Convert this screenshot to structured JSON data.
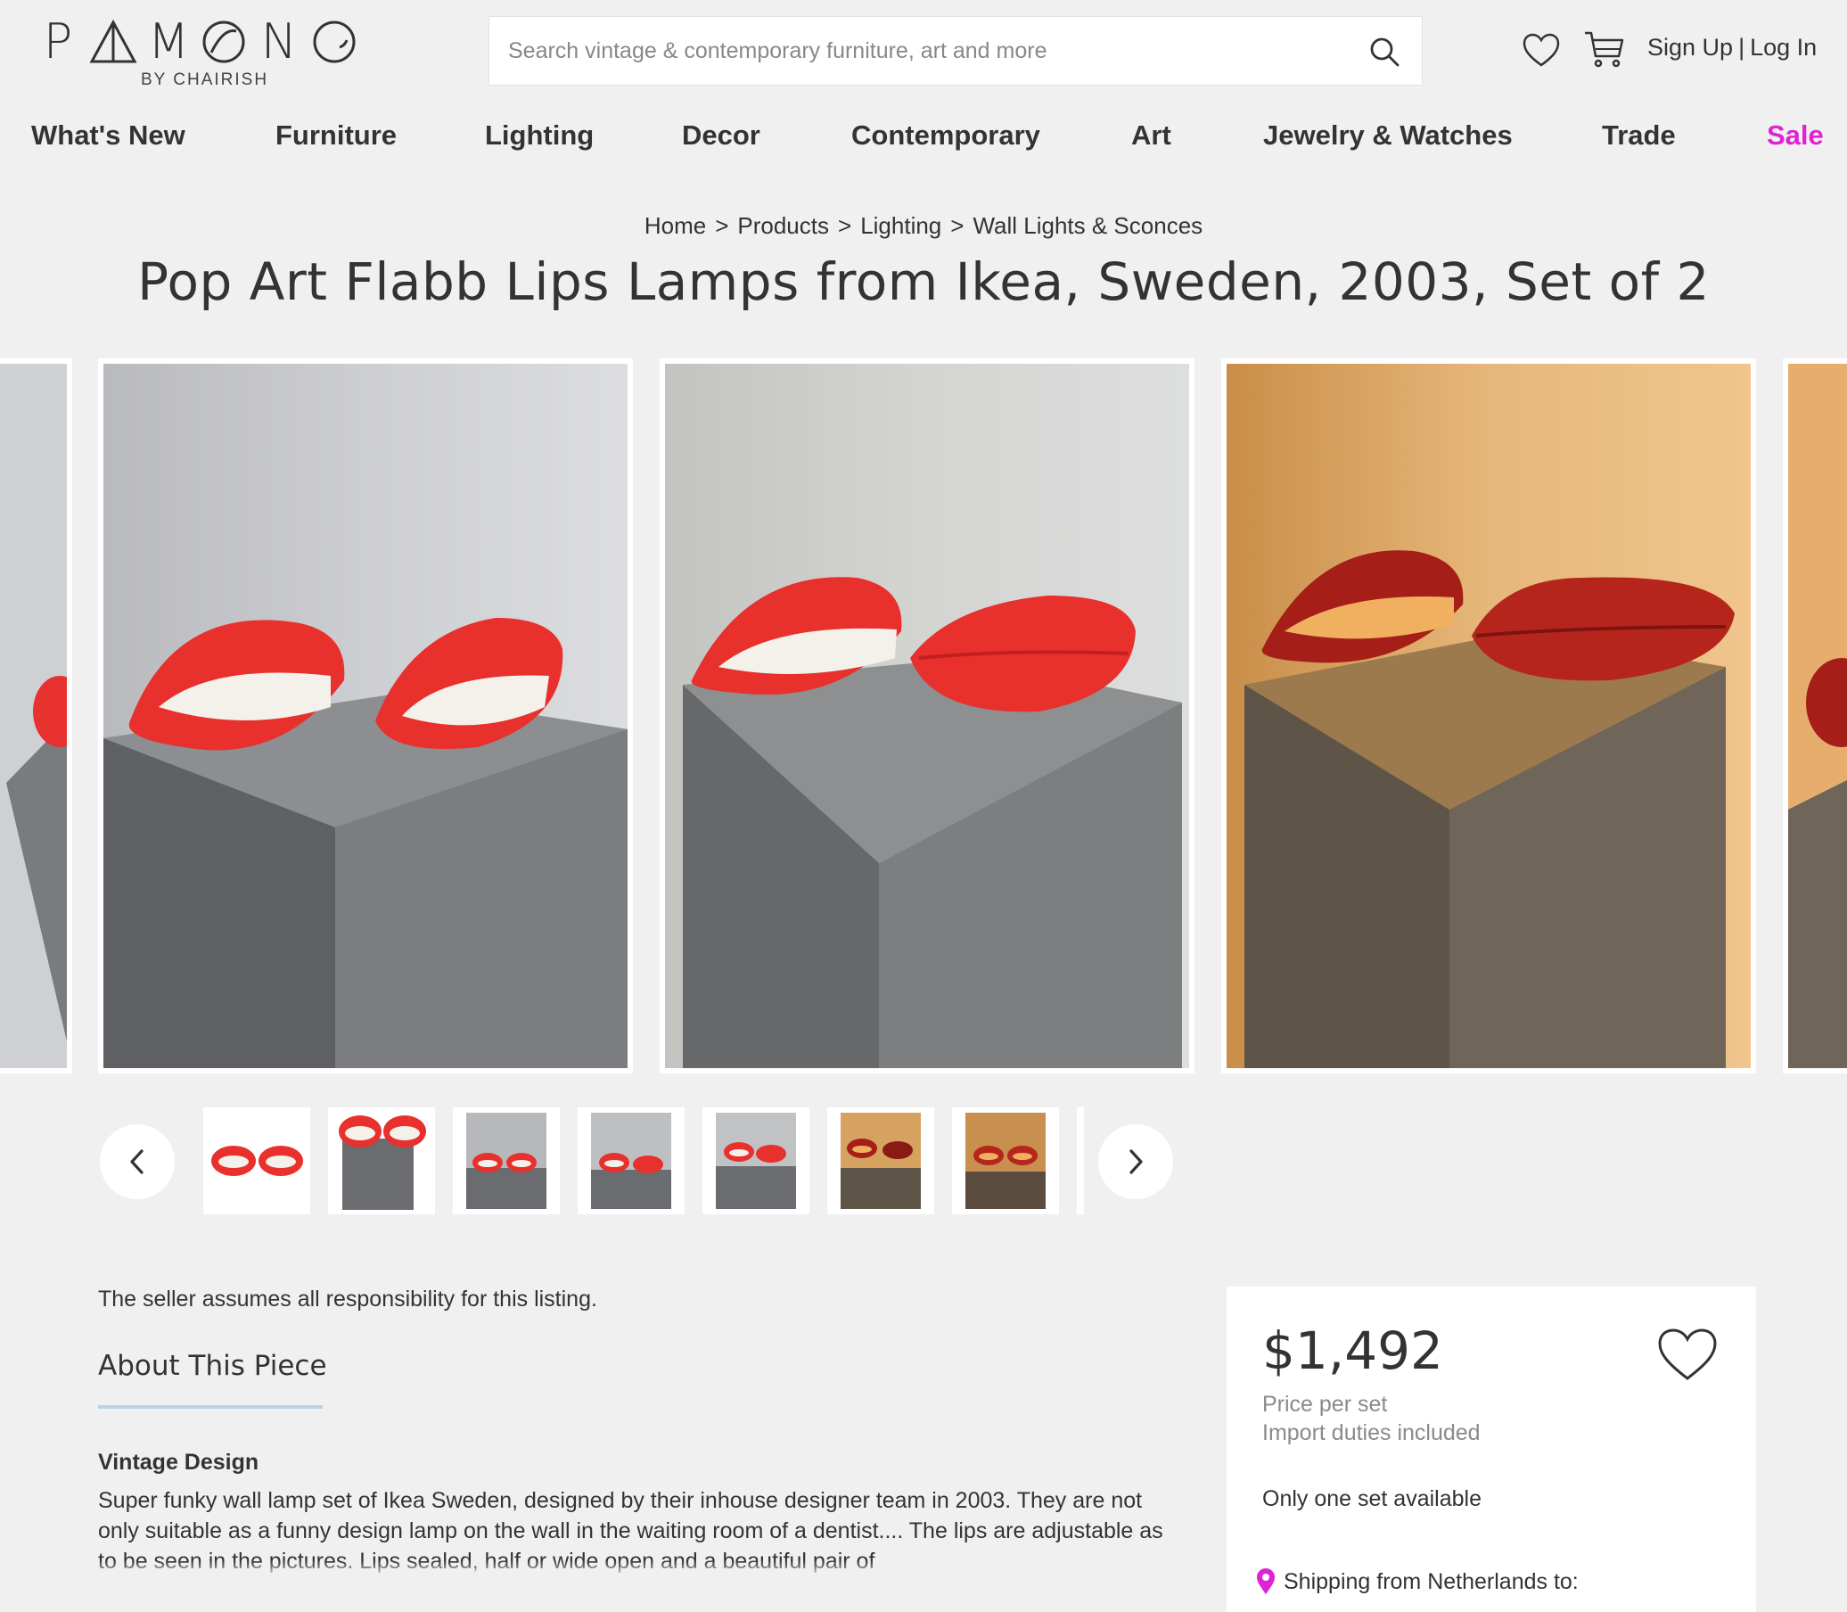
{
  "brand": {
    "name": "PAMONO",
    "letters": [
      "P",
      "A",
      "M",
      "O",
      "N",
      "O"
    ],
    "sub": "BY CHAIRISH"
  },
  "search": {
    "placeholder": "Search vintage & contemporary furniture, art and more",
    "icon": "search-icon"
  },
  "header": {
    "wishlist_icon": "heart-icon",
    "cart_icon": "cart-icon",
    "sign_up": "Sign Up",
    "separator": "|",
    "log_in": "Log In"
  },
  "nav": {
    "items": [
      {
        "label": "What's New"
      },
      {
        "label": "Furniture"
      },
      {
        "label": "Lighting"
      },
      {
        "label": "Decor"
      },
      {
        "label": "Contemporary"
      },
      {
        "label": "Art"
      },
      {
        "label": "Jewelry & Watches"
      },
      {
        "label": "Trade"
      },
      {
        "label": "Sale"
      }
    ],
    "sale_color": "#e021d6"
  },
  "breadcrumb": {
    "items": [
      "Home",
      "Products",
      "Lighting",
      "Wall Lights & Sconces"
    ],
    "separator": ">"
  },
  "product": {
    "title": "Pop Art Flabb Lips Lamps from Ikea, Sweden, 2003, Set of 2",
    "seller_note": "The seller assumes all responsibility for this listing.",
    "about_heading": "About This Piece",
    "section_heading": "Vintage Design",
    "description": "Super funky wall lamp set of Ikea Sweden, designed by their inhouse designer team in 2003. They are not only suitable as a funny design lamp on the wall in the waiting room of a dentist.... The lips are adjustable as to be seen in the pictures. Lips sealed, half or wide open and a beautiful pair of"
  },
  "gallery": {
    "images": [
      "lips-lamps-photo",
      "lips-lamps-photo",
      "lips-lamps-photo-lit"
    ],
    "prev_icon": "chevron-left-icon",
    "next_icon": "chevron-right-icon",
    "thumbnail_count": 7
  },
  "pricing": {
    "price": "$1,492",
    "per": "Price per set",
    "duties": "Import duties included",
    "availability": "Only one set available",
    "shipping": "Shipping from Netherlands to:",
    "shipping_icon": "location-pin-icon",
    "favorite_icon": "heart-icon"
  }
}
